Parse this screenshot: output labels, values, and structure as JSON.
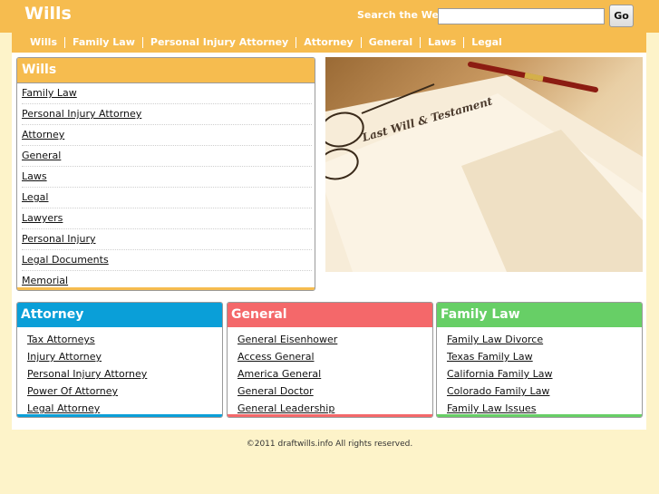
{
  "header": {
    "logo": "Wills",
    "search_label": "Search the Web:",
    "search_value": "",
    "go_label": "Go"
  },
  "nav": [
    "Wills",
    "Family Law",
    "Personal Injury Attorney",
    "Attorney",
    "General",
    "Laws",
    "Legal"
  ],
  "wills_box": {
    "title": "Wills",
    "items": [
      "Family Law",
      "Personal Injury Attorney",
      "Attorney",
      "General",
      "Laws",
      "Legal",
      "Lawyers",
      "Personal Injury",
      "Legal Documents",
      "Memorial"
    ]
  },
  "hero": {
    "document_text": "Last Will & Testament"
  },
  "columns": [
    {
      "title": "Attorney",
      "color": "#0a9fd8",
      "items": [
        "Tax Attorneys",
        "Injury Attorney",
        "Personal Injury Attorney",
        "Power Of Attorney",
        "Legal Attorney"
      ]
    },
    {
      "title": "General",
      "color": "#f4686a",
      "items": [
        "General Eisenhower",
        "Access General",
        "America General",
        "General Doctor",
        "General Leadership"
      ]
    },
    {
      "title": "Family Law",
      "color": "#67cf66",
      "items": [
        "Family Law Divorce",
        "Texas Family Law",
        "California Family Law",
        "Colorado Family Law",
        "Family Law Issues"
      ]
    }
  ],
  "colors": {
    "accent": "#f6bc4f",
    "page_background": "#fdf3c9"
  },
  "footer": "©2011 draftwills.info All rights reserved."
}
